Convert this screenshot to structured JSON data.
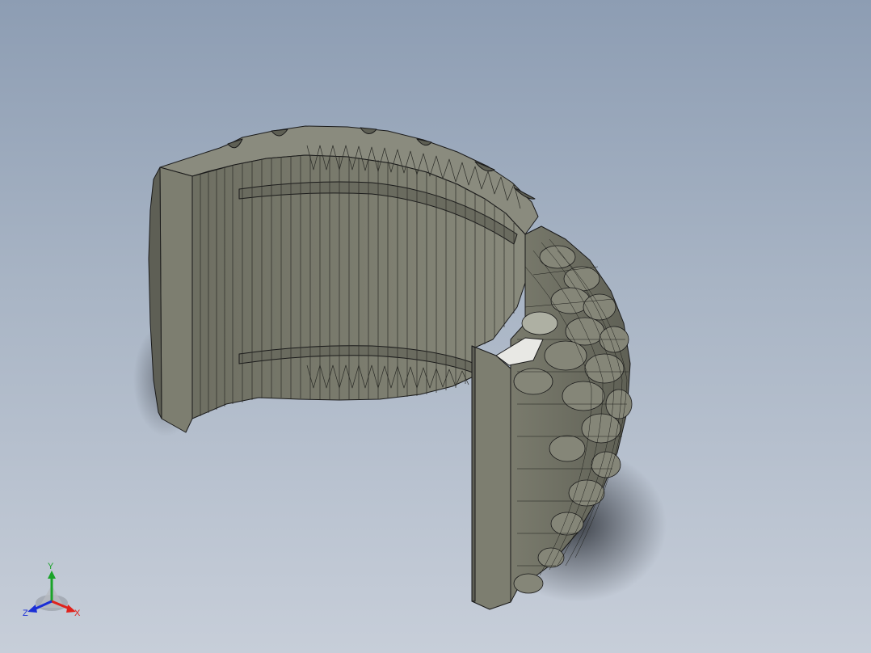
{
  "viewport": {
    "background_top": "#8d9db3",
    "background_bottom": "#c7ced9"
  },
  "model": {
    "shape": "tire-section",
    "face_color": "#7c7d6f",
    "edge_color": "#1a1a1a",
    "highlight_color": "#e8e8e4"
  },
  "triad": {
    "y_label": "Y",
    "x_label": "X",
    "z_label": "Z",
    "y_color": "#1aa329",
    "x_color": "#e0221c",
    "z_color": "#1b2fd6"
  }
}
